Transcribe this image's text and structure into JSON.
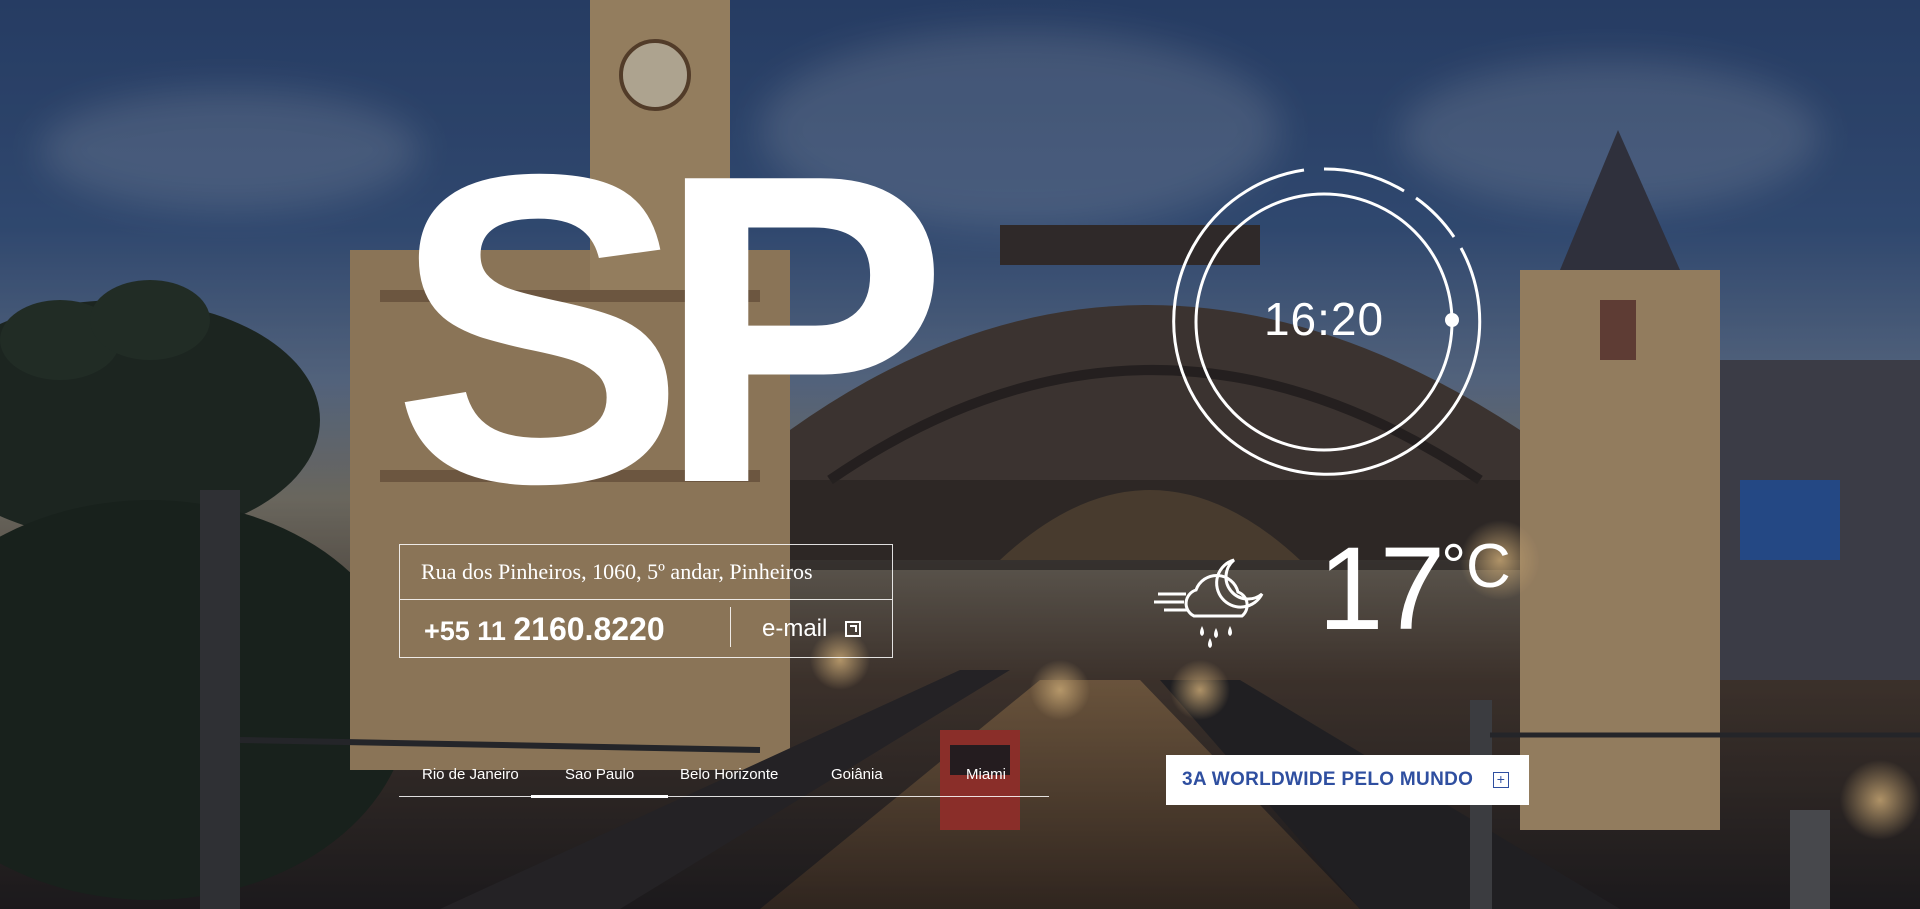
{
  "hero": {
    "city_code": "SP"
  },
  "contact": {
    "address": "Rua dos Pinheiros, 1060, 5º andar, Pinheiros",
    "phone_prefix": "+55 11",
    "phone_number": "2160.8220",
    "email_label": "e-mail",
    "email_icon": "external-link-icon"
  },
  "clock": {
    "time": "16:20"
  },
  "weather": {
    "icon": "cloud-moon-rain-icon",
    "temperature": "17",
    "unit": "°C"
  },
  "city_nav": {
    "active": "Sao Paulo",
    "items": [
      {
        "label": "Rio de Janeiro"
      },
      {
        "label": "Sao Paulo"
      },
      {
        "label": "Belo Horizonte"
      },
      {
        "label": "Goiânia"
      },
      {
        "label": "Miami"
      }
    ]
  },
  "cta": {
    "label": "3A WORLDWIDE PELO MUNDO",
    "icon": "plus-icon",
    "icon_text": "+"
  },
  "colors": {
    "accent": "#2f4fa0",
    "overlay": "#141826",
    "text": "#ffffff"
  }
}
